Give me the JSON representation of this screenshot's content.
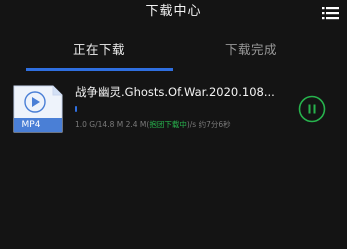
{
  "header": {
    "title": "下载中心",
    "menu_icon": "list-icon"
  },
  "tabs": [
    {
      "label": "正在下载",
      "active": true
    },
    {
      "label": "下载完成",
      "active": false
    }
  ],
  "downloads": [
    {
      "name": "战争幽灵.Ghosts.Of.War.2020.108...",
      "file_type": "MP4",
      "progress_fraction": 0.01,
      "downloaded": "1.0 G/14.8 M",
      "speed": "2.4 M",
      "status_open": "(",
      "status": "抱团下载中",
      "status_close": ")",
      "remaining": "/s 约7分6秒",
      "action_icon": "pause-icon"
    }
  ],
  "colors": {
    "background": "#141414",
    "accent_blue": "#2f6fe0",
    "accent_green": "#27b34d",
    "file_icon_blue": "#4a7fd6"
  }
}
